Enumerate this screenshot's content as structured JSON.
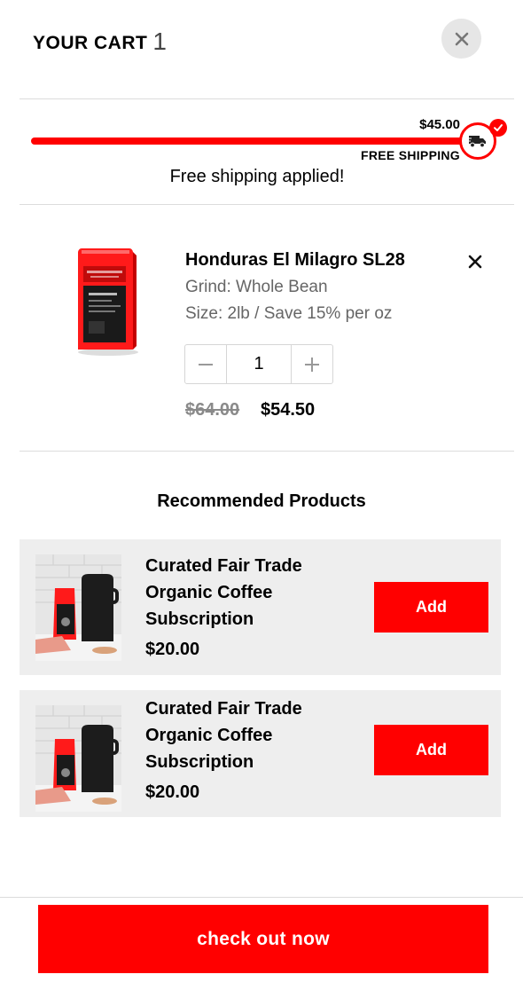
{
  "header": {
    "title": "YOUR CART",
    "count": "1"
  },
  "shipping": {
    "threshold": "$45.00",
    "label": "FREE SHIPPING",
    "message": "Free shipping applied!",
    "progress": 1.0
  },
  "cart_item": {
    "name": "Honduras El Milagro SL28",
    "grind": "Grind: Whole Bean",
    "size": "Size: 2lb / Save 15% per oz",
    "quantity": "1",
    "original_price": "$64.00",
    "price": "$54.50"
  },
  "recommended": {
    "heading": "Recommended Products",
    "items": [
      {
        "line1": "Curated Fair Trade",
        "line2": "Organic Coffee",
        "line3": "Subscription",
        "price": "$20.00",
        "add_label": "Add"
      },
      {
        "line1": "Curated Fair Trade",
        "line2": "Organic Coffee",
        "line3": "Subscription",
        "price": "$20.00",
        "add_label": "Add"
      }
    ]
  },
  "checkout": {
    "label": "check out now"
  },
  "colors": {
    "accent": "#ff0000",
    "card_bg": "#eeeeee",
    "muted_text": "#666666"
  },
  "icons": [
    "close-icon",
    "truck-icon",
    "check-icon",
    "remove-icon",
    "minus-icon",
    "plus-icon"
  ]
}
